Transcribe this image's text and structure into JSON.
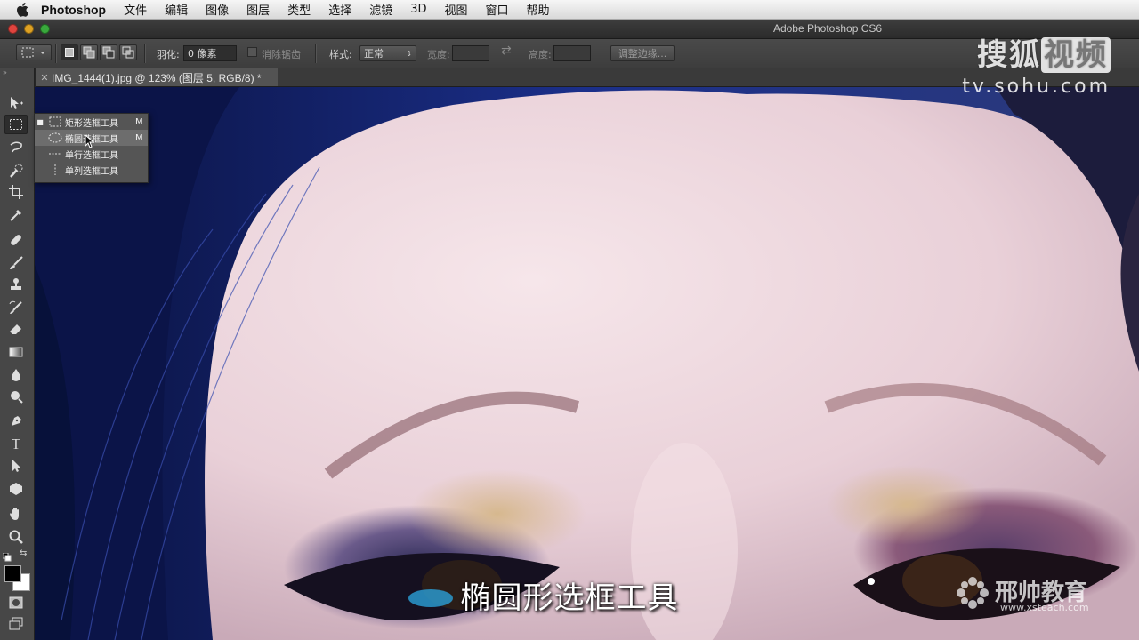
{
  "menubar": {
    "app_name": "Photoshop",
    "items": [
      "文件",
      "编辑",
      "图像",
      "图层",
      "类型",
      "选择",
      "滤镜",
      "3D",
      "视图",
      "窗口",
      "帮助"
    ]
  },
  "window": {
    "title": "Adobe Photoshop CS6"
  },
  "options_bar": {
    "feather_label": "羽化:",
    "feather_value": "0 像素",
    "antialias_label": "消除锯齿",
    "style_label": "样式:",
    "style_value": "正常",
    "width_label": "宽度:",
    "height_label": "高度:",
    "refine_edge_label": "调整边缘..."
  },
  "document_tab": {
    "title": "IMG_1444(1).jpg @ 123% (图层 5, RGB/8) *"
  },
  "tool_flyout": {
    "items": [
      {
        "label": "矩形选框工具",
        "shortcut": "M",
        "icon": "rect-marquee-icon",
        "current": true
      },
      {
        "label": "椭圆选框工具",
        "shortcut": "M",
        "icon": "ellipse-marquee-icon",
        "hovered": true
      },
      {
        "label": "单行选框工具",
        "shortcut": "",
        "icon": "single-row-marquee-icon"
      },
      {
        "label": "单列选框工具",
        "shortcut": "",
        "icon": "single-column-marquee-icon"
      }
    ]
  },
  "toolbar": {
    "tools": [
      "move-tool",
      "marquee-tool",
      "lasso-tool",
      "quick-selection-tool",
      "crop-tool",
      "eyedropper-tool",
      "healing-brush-tool",
      "brush-tool",
      "clone-stamp-tool",
      "history-brush-tool",
      "eraser-tool",
      "gradient-tool",
      "blur-tool",
      "dodge-tool",
      "pen-tool",
      "type-tool",
      "path-selection-tool",
      "shape-tool",
      "hand-tool",
      "zoom-tool"
    ],
    "foreground_color": "#000000",
    "background_color": "#ffffff"
  },
  "overlays": {
    "subtitle": "椭圆形选框工具",
    "sohu_logo_a": "搜狐",
    "sohu_logo_b": "视频",
    "sohu_url": "tv.sohu.com",
    "brand_name": "邢帅教育",
    "brand_site": "www.xsteach.com"
  },
  "colors": {
    "ui_dark": "#474747",
    "skin": "#eed9dd",
    "hair": "#1b2a6a"
  }
}
